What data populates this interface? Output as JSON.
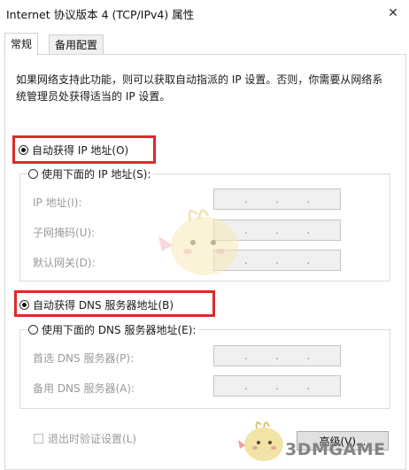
{
  "window": {
    "title": "Internet 协议版本 4 (TCP/IPv4) 属性",
    "close_glyph": "✕"
  },
  "tabs": [
    {
      "label": "常规",
      "active": true
    },
    {
      "label": "备用配置",
      "active": false
    }
  ],
  "description": "如果网络支持此功能，则可以获取自动指派的 IP 设置。否则，你需要从网络系统管理员处获得适当的 IP 设置。",
  "ip": {
    "auto_label": "自动获得 IP 地址(O)",
    "auto_selected": true,
    "manual_label": "使用下面的 IP 地址(S):",
    "fields": [
      {
        "label": "IP 地址(I):",
        "dots": "."
      },
      {
        "label": "子网掩码(U):",
        "dots": "."
      },
      {
        "label": "默认网关(D):",
        "dots": "."
      }
    ]
  },
  "dns": {
    "auto_label": "自动获得 DNS 服务器地址(B)",
    "auto_selected": true,
    "manual_label": "使用下面的 DNS 服务器地址(E):",
    "fields": [
      {
        "label": "首选 DNS 服务器(P):",
        "dots": "."
      },
      {
        "label": "备用 DNS 服务器(A):",
        "dots": "."
      }
    ]
  },
  "validate_label": "退出时验证设置(L)",
  "advanced_label": "高级(V)...",
  "watermark": "3DMGAME",
  "colors": {
    "highlight": "#d92b2b",
    "disabled_text": "#9a9a9a",
    "field_bg": "#f0f0f0",
    "mascot_fill": "#f5e9b8"
  }
}
